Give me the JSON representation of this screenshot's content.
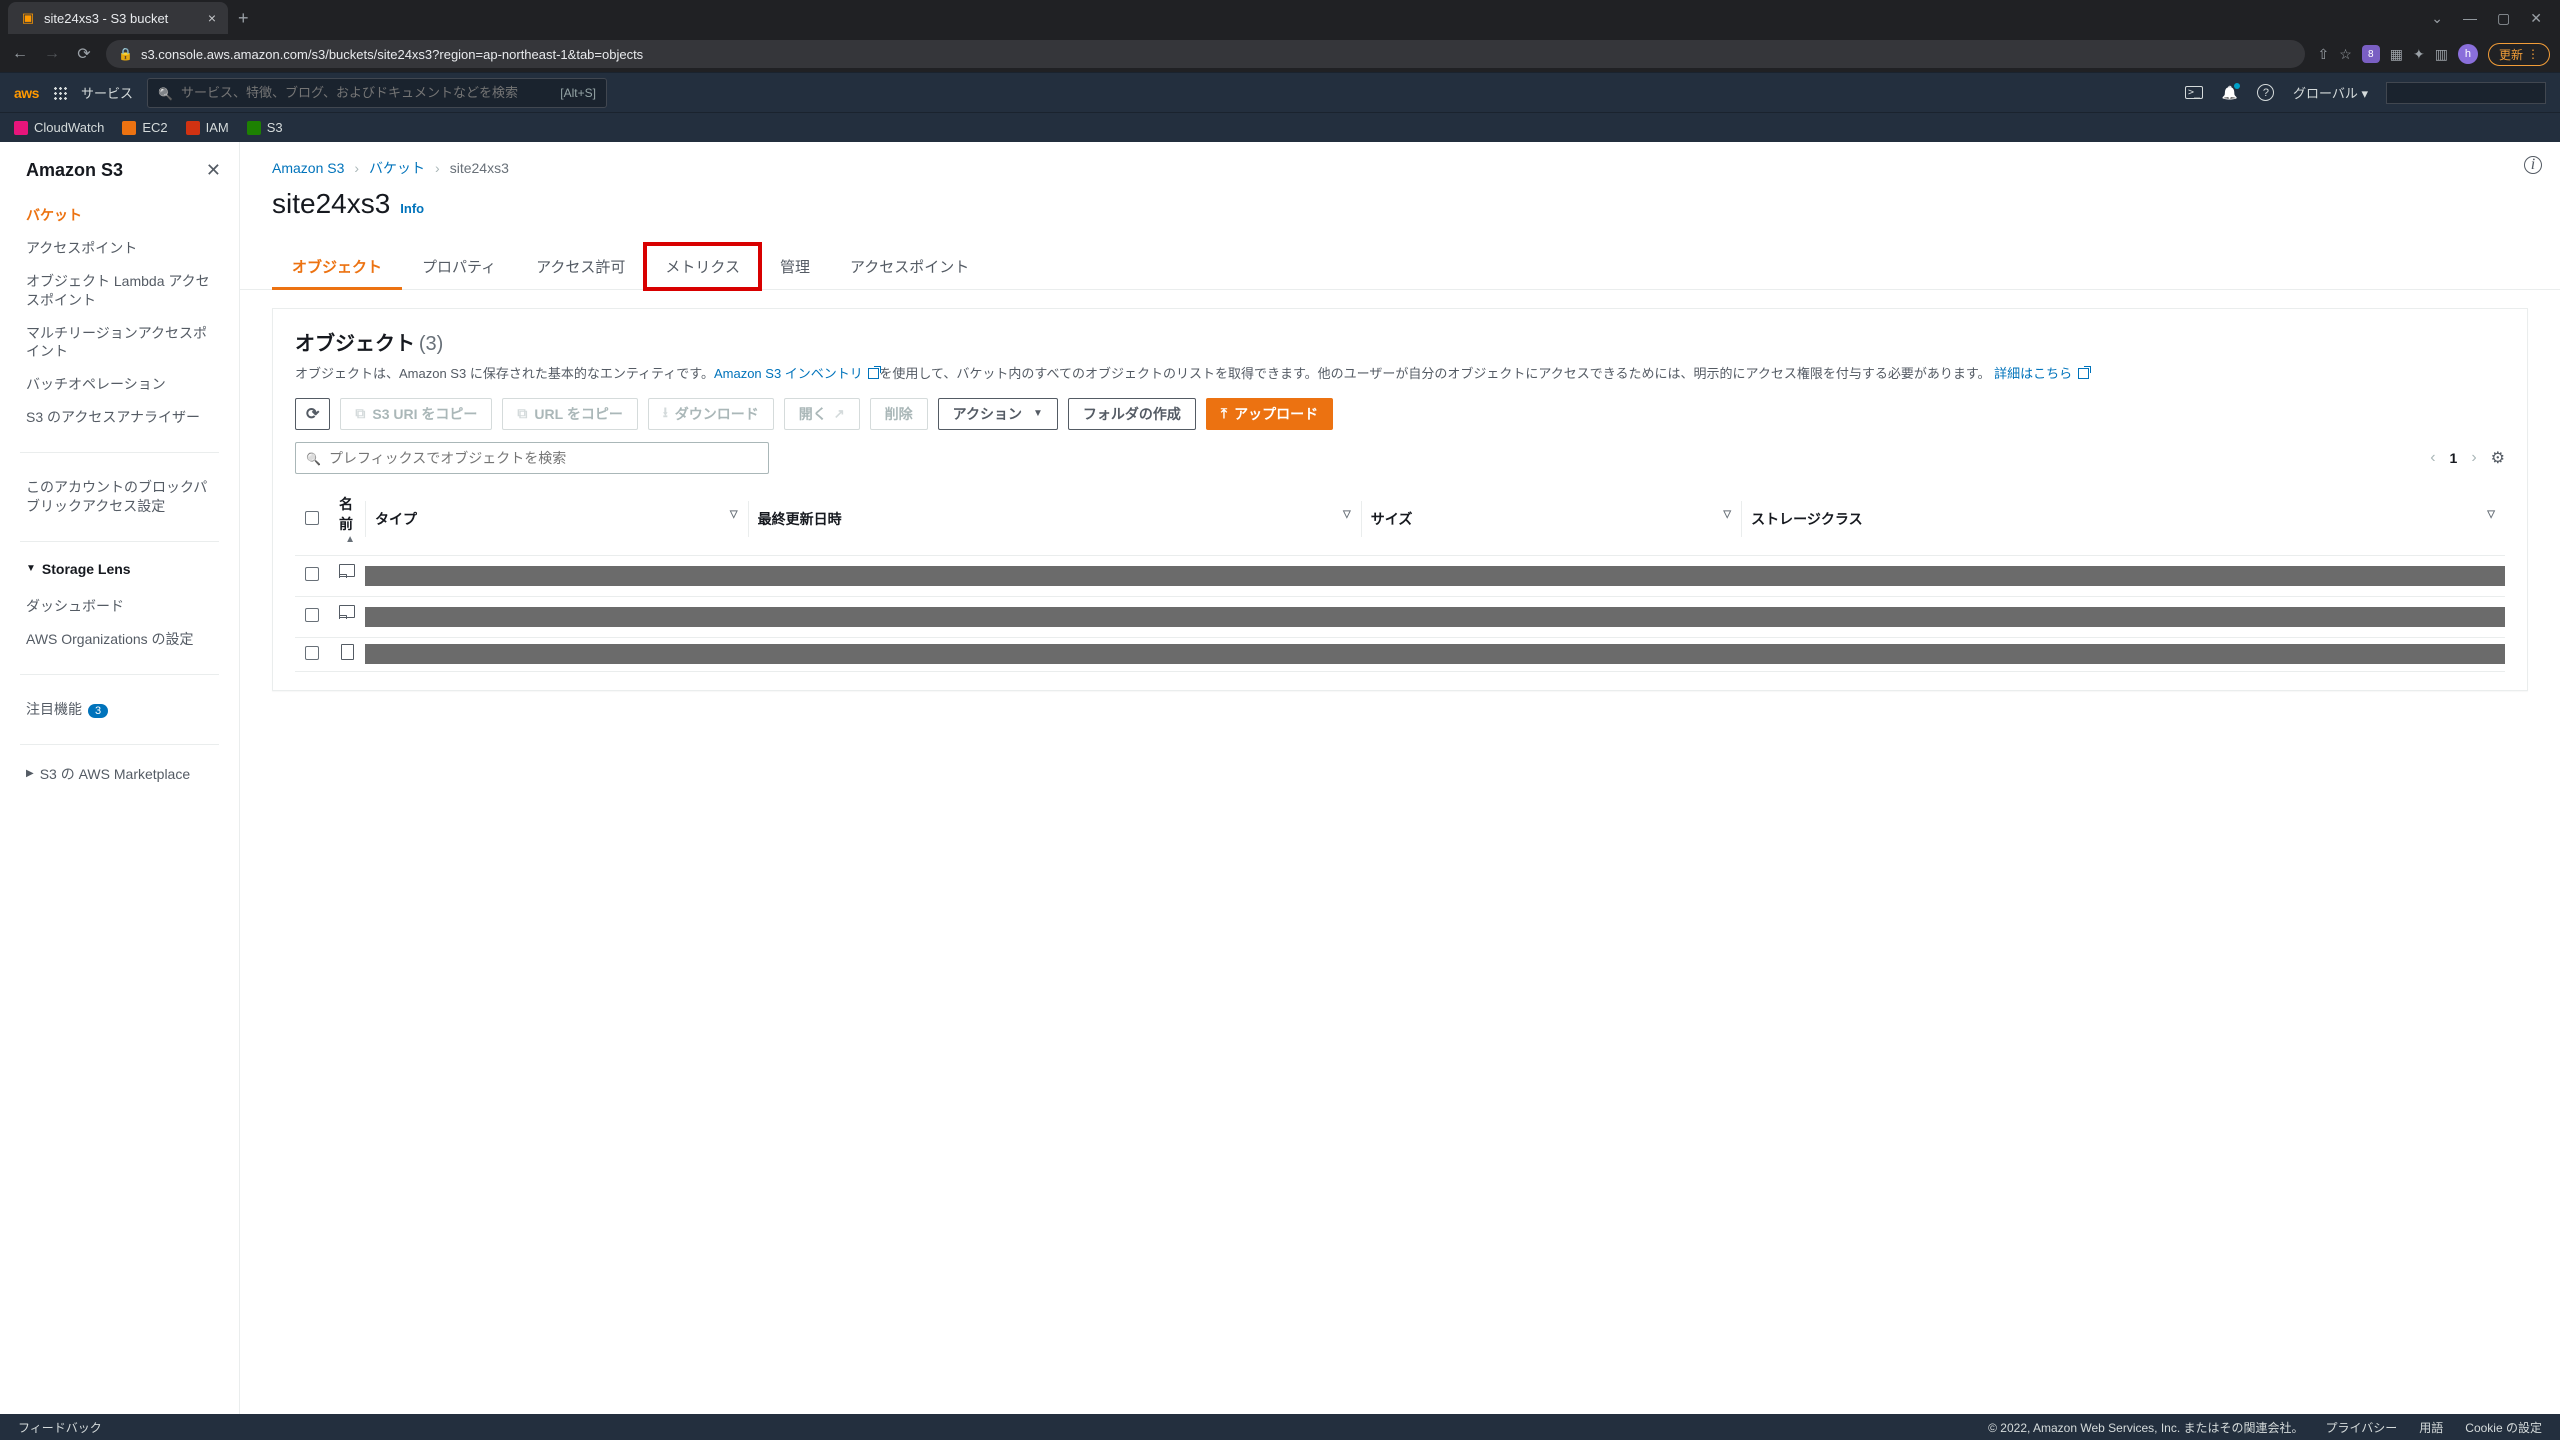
{
  "browser": {
    "tab_title": "site24xs3 - S3 bucket",
    "url": "s3.console.aws.amazon.com/s3/buckets/site24xs3?region=ap-northeast-1&tab=objects",
    "update_label": "更新",
    "ext_badge": "8",
    "avatar_letter": "h"
  },
  "aws_header": {
    "logo": "aws",
    "services": "サービス",
    "search_placeholder": "サービス、特徴、ブログ、およびドキュメントなどを検索",
    "search_kbd": "[Alt+S]",
    "region": "グローバル ▾"
  },
  "bookmarks": [
    {
      "label": "CloudWatch",
      "color": "sq-pink"
    },
    {
      "label": "EC2",
      "color": "sq-orange"
    },
    {
      "label": "IAM",
      "color": "sq-red"
    },
    {
      "label": "S3",
      "color": "sq-green"
    }
  ],
  "sidebar": {
    "title": "Amazon S3",
    "items_a": [
      "バケット",
      "アクセスポイント",
      "オブジェクト Lambda アクセスポイント",
      "マルチリージョンアクセスポイント",
      "バッチオペレーション",
      "S3 のアクセスアナライザー"
    ],
    "items_b": [
      "このアカウントのブロックパブリックアクセス設定"
    ],
    "group_storage": "Storage Lens",
    "items_c": [
      "ダッシュボード",
      "AWS Organizations の設定"
    ],
    "featured": "注目機能",
    "featured_badge": "3",
    "marketplace": "S3 の AWS Marketplace"
  },
  "breadcrumbs": {
    "a": "Amazon S3",
    "b": "バケット",
    "c": "site24xs3"
  },
  "page": {
    "title": "site24xs3",
    "info": "Info"
  },
  "tabs": [
    "オブジェクト",
    "プロパティ",
    "アクセス許可",
    "メトリクス",
    "管理",
    "アクセスポイント"
  ],
  "tabs_active": 0,
  "tabs_highlight": 3,
  "panel": {
    "title": "オブジェクト",
    "count": "(3)",
    "desc1": "オブジェクトは、Amazon S3 に保存された基本的なエンティティです。",
    "link1": "Amazon S3 インベントリ",
    "desc2": "を使用して、バケット内のすべてのオブジェクトのリストを取得できます。他のユーザーが自分のオブジェクトにアクセスできるためには、明示的にアクセス権限を付与する必要があります。",
    "link2": "詳細はこちら"
  },
  "toolbar": {
    "copy_s3_uri": "S3 URI をコピー",
    "copy_url": "URL をコピー",
    "download": "ダウンロード",
    "open": "開く",
    "delete": "削除",
    "actions": "アクション",
    "create_folder": "フォルダの作成",
    "upload": "アップロード"
  },
  "search": {
    "placeholder": "プレフィックスでオブジェクトを検索"
  },
  "pager": {
    "page": "1"
  },
  "columns": {
    "name": "名前",
    "type": "タイプ",
    "modified": "最終更新日時",
    "size": "サイズ",
    "storage": "ストレージクラス"
  },
  "rows": [
    {
      "icon": "folder"
    },
    {
      "icon": "folder"
    },
    {
      "icon": "file"
    }
  ],
  "footer": {
    "feedback": "フィードバック",
    "copyright": "© 2022, Amazon Web Services, Inc. またはその関連会社。",
    "privacy": "プライバシー",
    "terms": "用語",
    "cookie": "Cookie の設定"
  }
}
